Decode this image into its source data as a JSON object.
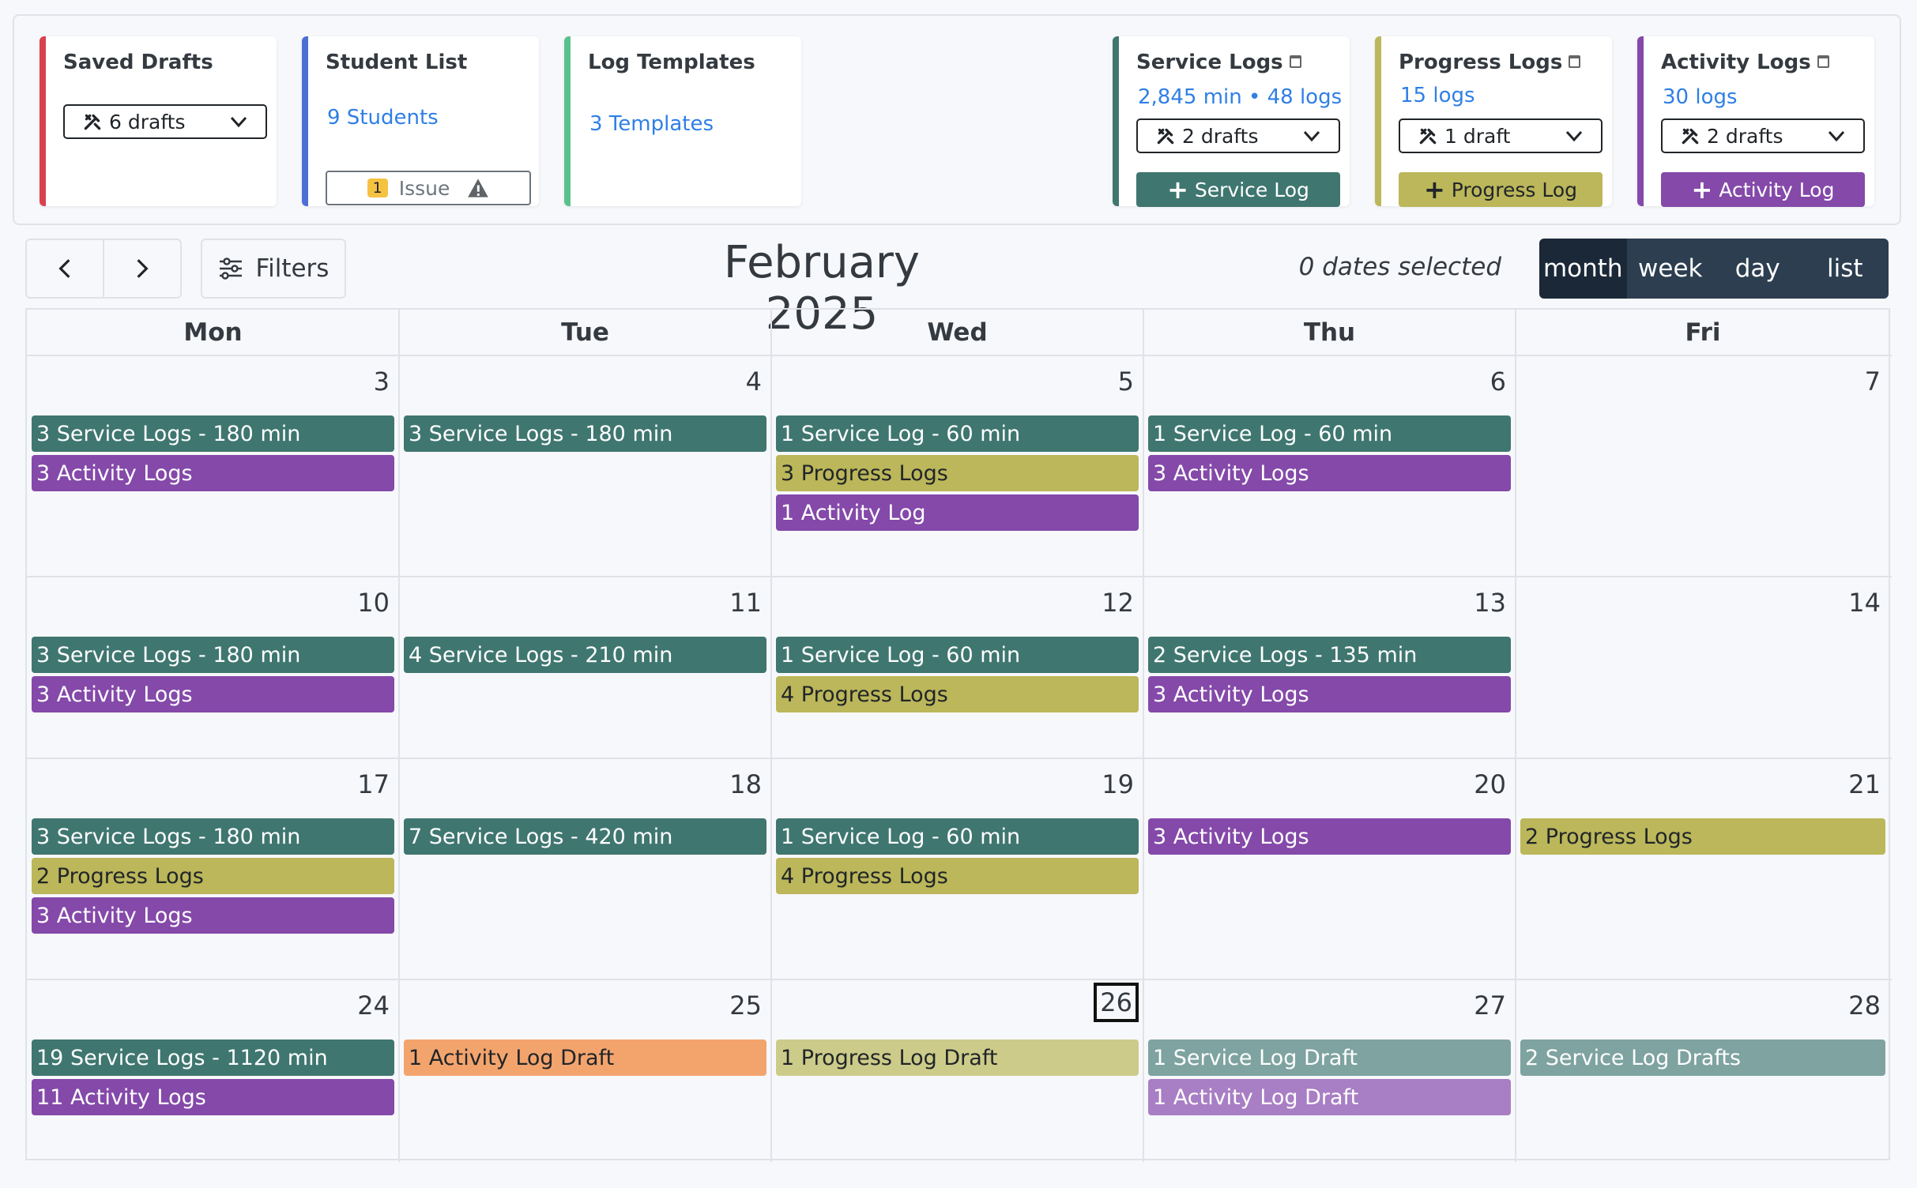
{
  "colors": {
    "service": "#3f7670",
    "progress": "#bbb75a",
    "activity": "#8449a9",
    "activity_draft_orange": "#f3a46d",
    "progress_draft": "#cccb89",
    "service_draft": "#7ea3a0",
    "activity_draft": "#a87ec4"
  },
  "cards": {
    "saved_drafts": {
      "title": "Saved Drafts",
      "select": "6 drafts"
    },
    "student_list": {
      "title": "Student List",
      "link": "9 Students",
      "issue_count": "1",
      "issue_label": "Issue"
    },
    "log_templates": {
      "title": "Log Templates",
      "link": "3 Templates"
    },
    "service_logs": {
      "title": "Service Logs",
      "stats": "2,845 min • 48 logs",
      "select": "2 drafts",
      "button": "Service Log"
    },
    "progress_logs": {
      "title": "Progress Logs",
      "stats": "15 logs",
      "select": "1 draft",
      "button": "Progress Log"
    },
    "activity_logs": {
      "title": "Activity Logs",
      "stats": "30 logs",
      "select": "2 drafts",
      "button": "Activity Log"
    }
  },
  "toolbar": {
    "prev_icon": "chevron-left-icon",
    "next_icon": "chevron-right-icon",
    "filters_label": "Filters",
    "title": "February 2025",
    "dates_selected": "0 dates selected",
    "views": [
      "month",
      "week",
      "day",
      "list"
    ],
    "active_view": "month"
  },
  "calendar": {
    "day_headers": [
      "Mon",
      "Tue",
      "Wed",
      "Thu",
      "Fri"
    ],
    "today": "26",
    "weeks": [
      [
        {
          "date": "3",
          "events": [
            {
              "label": "3 Service Logs - 180 min",
              "type": "service"
            },
            {
              "label": "3 Activity Logs",
              "type": "activity"
            }
          ]
        },
        {
          "date": "4",
          "events": [
            {
              "label": "3 Service Logs - 180 min",
              "type": "service"
            }
          ]
        },
        {
          "date": "5",
          "events": [
            {
              "label": "1 Service Log - 60 min",
              "type": "service"
            },
            {
              "label": "3 Progress Logs",
              "type": "progress"
            },
            {
              "label": "1 Activity Log",
              "type": "activity"
            }
          ]
        },
        {
          "date": "6",
          "events": [
            {
              "label": "1 Service Log - 60 min",
              "type": "service"
            },
            {
              "label": "3 Activity Logs",
              "type": "activity"
            }
          ]
        },
        {
          "date": "7",
          "events": []
        }
      ],
      [
        {
          "date": "10",
          "events": [
            {
              "label": "3 Service Logs - 180 min",
              "type": "service"
            },
            {
              "label": "3 Activity Logs",
              "type": "activity"
            }
          ]
        },
        {
          "date": "11",
          "events": [
            {
              "label": "4 Service Logs - 210 min",
              "type": "service"
            }
          ]
        },
        {
          "date": "12",
          "events": [
            {
              "label": "1 Service Log - 60 min",
              "type": "service"
            },
            {
              "label": "4 Progress Logs",
              "type": "progress"
            }
          ]
        },
        {
          "date": "13",
          "events": [
            {
              "label": "2 Service Logs - 135 min",
              "type": "service"
            },
            {
              "label": "3 Activity Logs",
              "type": "activity"
            }
          ]
        },
        {
          "date": "14",
          "events": []
        }
      ],
      [
        {
          "date": "17",
          "events": [
            {
              "label": "3 Service Logs - 180 min",
              "type": "service"
            },
            {
              "label": "2 Progress Logs",
              "type": "progress"
            },
            {
              "label": "3 Activity Logs",
              "type": "activity"
            }
          ]
        },
        {
          "date": "18",
          "events": [
            {
              "label": "7 Service Logs - 420 min",
              "type": "service"
            }
          ]
        },
        {
          "date": "19",
          "events": [
            {
              "label": "1 Service Log - 60 min",
              "type": "service"
            },
            {
              "label": "4 Progress Logs",
              "type": "progress"
            }
          ]
        },
        {
          "date": "20",
          "events": [
            {
              "label": "3 Activity Logs",
              "type": "activity"
            }
          ]
        },
        {
          "date": "21",
          "events": [
            {
              "label": "2 Progress Logs",
              "type": "progress"
            }
          ]
        }
      ],
      [
        {
          "date": "24",
          "events": [
            {
              "label": "19 Service Logs - 1120 min",
              "type": "service"
            },
            {
              "label": "11 Activity Logs",
              "type": "activity"
            }
          ]
        },
        {
          "date": "25",
          "events": [
            {
              "label": "1 Activity Log Draft",
              "type": "activity_draft_orange"
            }
          ]
        },
        {
          "date": "26",
          "events": [
            {
              "label": "1 Progress Log Draft",
              "type": "progress_draft"
            }
          ]
        },
        {
          "date": "27",
          "events": [
            {
              "label": "1 Service Log Draft",
              "type": "service_draft"
            },
            {
              "label": "1 Activity Log Draft",
              "type": "activity_draft"
            }
          ]
        },
        {
          "date": "28",
          "events": [
            {
              "label": "2 Service Log Drafts",
              "type": "service_draft"
            }
          ]
        }
      ]
    ]
  }
}
